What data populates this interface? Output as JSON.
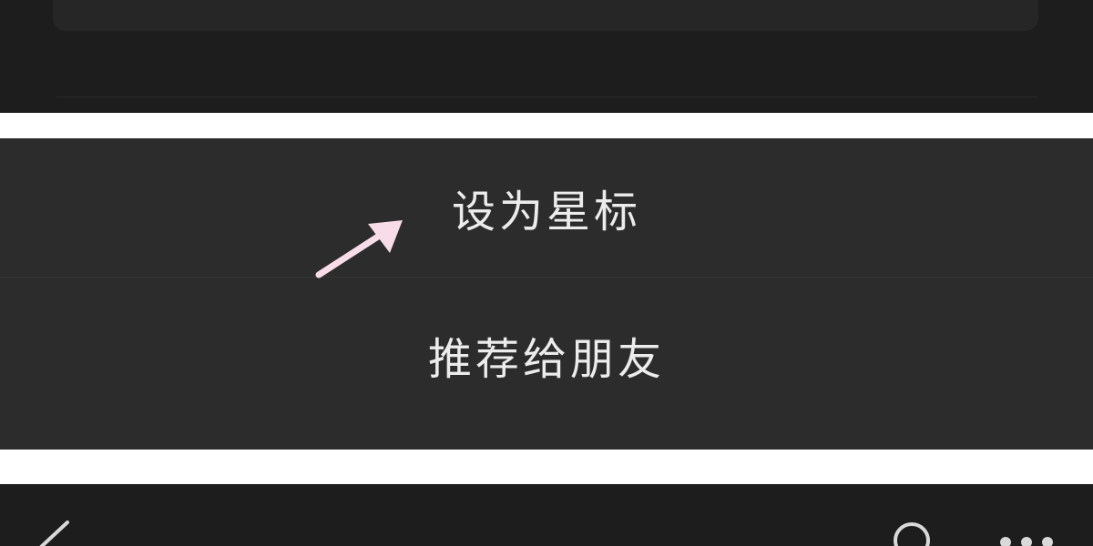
{
  "action_sheet": {
    "items": [
      {
        "label": "设为星标"
      },
      {
        "label": "推荐给朋友"
      }
    ]
  },
  "annotation": {
    "arrow_color": "#f8dde8"
  },
  "bottom_bar": {
    "icons": [
      "back-icon",
      "search-icon",
      "more-icon"
    ]
  },
  "colors": {
    "dark_background": "#1d1d1d",
    "sheet_background": "#2c2c2c",
    "text": "#ececec"
  }
}
